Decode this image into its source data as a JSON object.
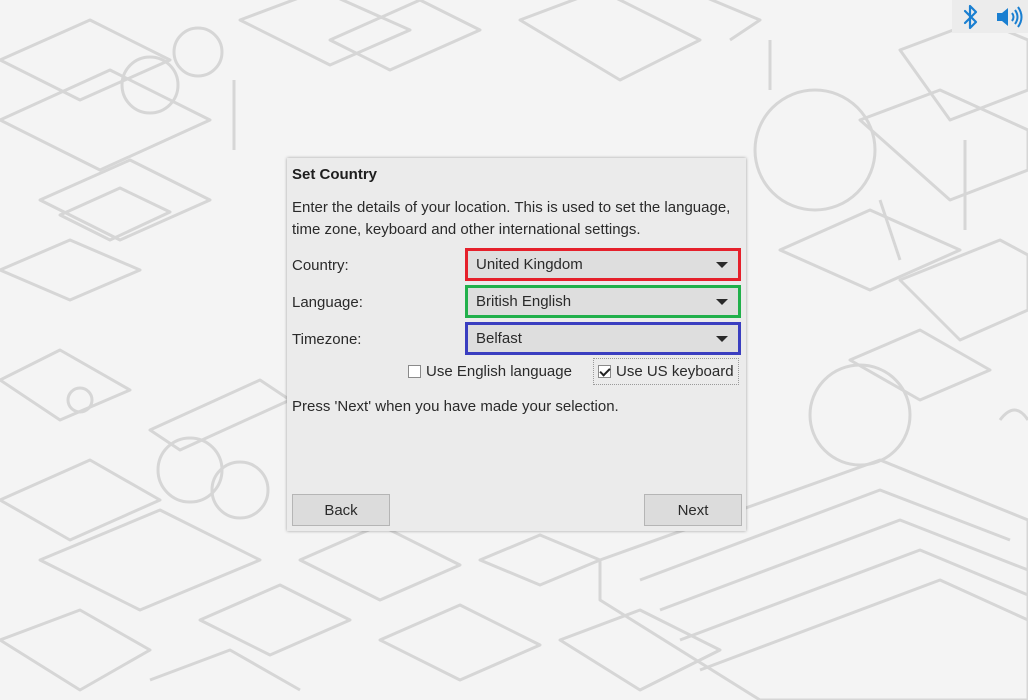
{
  "tray": {
    "icons": [
      "bluetooth-icon",
      "volume-icon"
    ],
    "accent": "#1a7fd1"
  },
  "dialog": {
    "title": "Set Country",
    "intro": "Enter the details of your location. This is used to set the language, time zone, keyboard and other international settings.",
    "country": {
      "label": "Country:",
      "value": "United Kingdom"
    },
    "language": {
      "label": "Language:",
      "value": "British English"
    },
    "timezone": {
      "label": "Timezone:",
      "value": "Belfast"
    },
    "use_english": {
      "label": "Use English language",
      "checked": false
    },
    "use_us_keyboard": {
      "label": "Use US keyboard",
      "checked": true
    },
    "hint": "Press 'Next' when you have made your selection.",
    "back_label": "Back",
    "next_label": "Next"
  },
  "highlight_colors": {
    "country": "#e5202b",
    "language": "#21b04b",
    "timezone": "#3a3ec0"
  }
}
